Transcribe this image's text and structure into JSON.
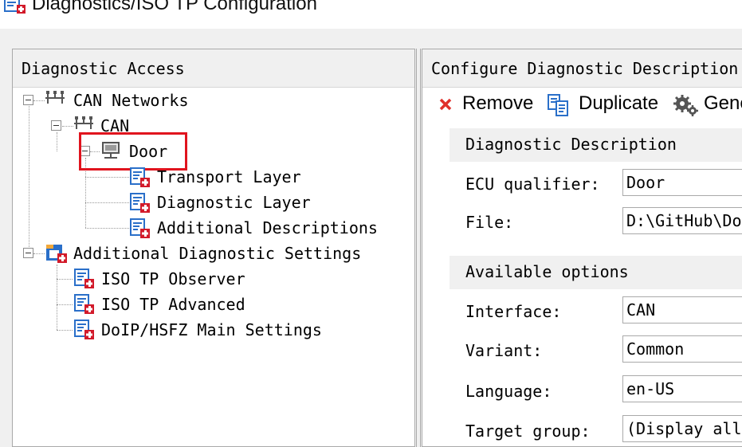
{
  "window": {
    "title": "Diagnostics/ISO TP Configuration"
  },
  "left_panel": {
    "header": "Diagnostic Access",
    "tree": {
      "can_networks": "CAN Networks",
      "can": "CAN",
      "door": "Door",
      "transport_layer": "Transport Layer",
      "diagnostic_layer": "Diagnostic Layer",
      "additional_descriptions": "Additional Descriptions",
      "additional_settings": "Additional Diagnostic Settings",
      "iso_tp_observer": "ISO TP Observer",
      "iso_tp_advanced": "ISO TP Advanced",
      "doip_hsfz": "DoIP/HSFZ Main Settings"
    },
    "highlight_color": "#e0141e"
  },
  "right_panel": {
    "header": "Configure Diagnostic Description",
    "toolbar": {
      "remove": "Remove",
      "duplicate": "Duplicate",
      "generate": "Gene"
    },
    "diagnostic_description": {
      "title": "Diagnostic Description",
      "ecu_qualifier_label": "ECU qualifier:",
      "ecu_qualifier_value": "Door",
      "file_label": "File:",
      "file_value": "D:\\GitHub\\Doo"
    },
    "available_options": {
      "title": "Available options",
      "interface_label": "Interface:",
      "interface_value": "CAN",
      "variant_label": "Variant:",
      "variant_value": "Common",
      "language_label": "Language:",
      "language_value": "en-US",
      "target_group_label": "Target group:",
      "target_group_value": "(Display all"
    }
  },
  "colors": {
    "remove_icon": "#e0302a",
    "doc_icon_blue": "#2a6fc9",
    "plus_red": "#d21a2a"
  }
}
